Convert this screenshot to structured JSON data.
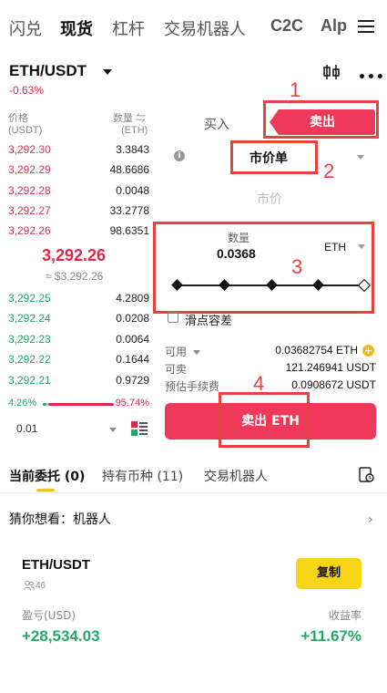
{
  "top_tabs": [
    "闪兑",
    "现货",
    "杠杆",
    "交易机器人",
    "C2C",
    "Alp"
  ],
  "pair": "ETH/USDT",
  "change": "-0.63%",
  "orderbook": {
    "price_header": "价格",
    "price_unit": "(USDT)",
    "amount_header": "数量 ⇋",
    "amount_unit": "(ETH)",
    "asks": [
      {
        "price": "3,292.30",
        "amount": "3.3843"
      },
      {
        "price": "3,292.29",
        "amount": "48.6686"
      },
      {
        "price": "3,292.28",
        "amount": "0.0048"
      },
      {
        "price": "3,292.27",
        "amount": "33.2778"
      },
      {
        "price": "3,292.26",
        "amount": "98.6351"
      }
    ],
    "mid_price": "3,292.26",
    "mid_usd": "≈ $3,292.26",
    "bids": [
      {
        "price": "3,292.25",
        "amount": "4.2809"
      },
      {
        "price": "3,292.24",
        "amount": "0.0208"
      },
      {
        "price": "3,292.23",
        "amount": "0.0064"
      },
      {
        "price": "3,292.22",
        "amount": "0.1644"
      },
      {
        "price": "3,292.21",
        "amount": "0.9729"
      }
    ],
    "buy_ratio": "4.26%",
    "sell_ratio": "95.74%",
    "buy_ratio_value": 4.26,
    "precision": "0.01"
  },
  "form": {
    "buy_tab": "买入",
    "sell_tab": "卖出",
    "order_type": "市价单",
    "price_placeholder": "市价",
    "qty_label": "数量",
    "qty_value": "0.0368",
    "qty_unit": "ETH",
    "slippage_label": "滑点容差",
    "available_label": "可用",
    "available_value": "0.03682754 ETH",
    "sellable_label": "可卖",
    "sellable_value": "121.246941 USDT",
    "fee_label": "预估手续费",
    "fee_value": "0.0908672 USDT",
    "submit_label": "卖出 ETH"
  },
  "annotations": [
    "1",
    "2",
    "3",
    "4"
  ],
  "bottom_tabs": {
    "orders": "当前委托 (0)",
    "holdings": "持有币种 (11)",
    "bots": "交易机器人"
  },
  "guess": {
    "label": "猜你想看：机器人"
  },
  "bot_card": {
    "pair": "ETH/USDT",
    "followers": "46",
    "copy_label": "复制",
    "pnl_label": "盈亏(USD)",
    "pnl_value": "+28,534.03",
    "roi_label": "收益率",
    "roi_value": "+11.67%"
  },
  "colors": {
    "sell_red": "#f0395a",
    "buy_green": "#25a86b",
    "annotation_red": "#e8423f",
    "copy_yellow": "#f7d516"
  }
}
